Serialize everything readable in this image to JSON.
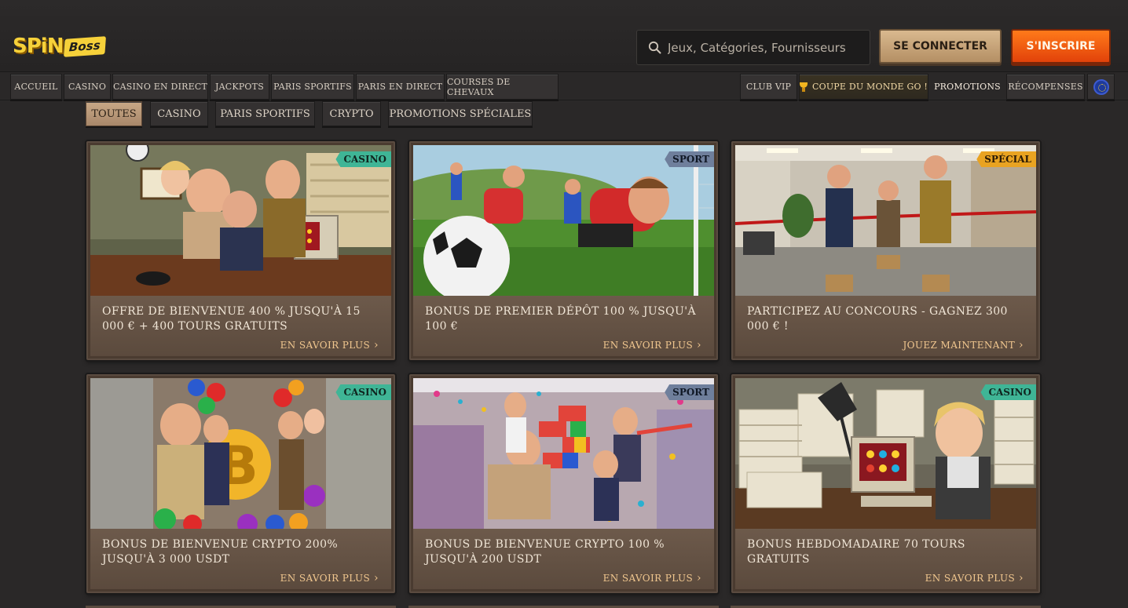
{
  "header": {
    "logo_main": "SPiN",
    "logo_sub": "Boss",
    "search_placeholder": "Jeux, Catégories, Fournisseurs",
    "login_label": "SE CONNECTER",
    "signup_label": "S'INSCRIRE"
  },
  "nav": {
    "left": [
      "ACCUEIL",
      "CASINO",
      "CASINO EN DIRECT",
      "JACKPOTS",
      "PARIS SPORTIFS",
      "PARIS EN DIRECT",
      "COURSES DE CHEVAUX"
    ],
    "club_vip": "CLUB VIP",
    "world_cup": "COUPE DU MONDE GO !",
    "promotions": "PROMOTIONS",
    "rewards": "RÉCOMPENSES"
  },
  "filters": [
    "TOUTES",
    "CASINO",
    "PARIS SPORTIFS",
    "CRYPTO",
    "PROMOTIONS SPÉCIALES"
  ],
  "cards": [
    {
      "tag": "CASINO",
      "title": "OFFRE DE BIENVENUE 400 % JUSQU'À 15 000 € + 400 TOURS GRATUITS",
      "cta": "EN SAVOIR PLUS"
    },
    {
      "tag": "SPORT",
      "title": "BONUS DE PREMIER DÉPÔT 100 % JUSQU'À 100 €",
      "cta": "EN SAVOIR PLUS"
    },
    {
      "tag": "SPÉCIAL",
      "title": "PARTICIPEZ AU CONCOURS - GAGNEZ 300 000 € !",
      "cta": "JOUEZ MAINTENANT"
    },
    {
      "tag": "CASINO",
      "title": "BONUS DE BIENVENUE CRYPTO 200% JUSQU'À 3 000 USDT",
      "cta": "EN SAVOIR PLUS"
    },
    {
      "tag": "SPORT",
      "title": "BONUS DE BIENVENUE CRYPTO 100 % JUSQU'À 200 USDT",
      "cta": "EN SAVOIR PLUS"
    },
    {
      "tag": "CASINO",
      "title": "BONUS HEBDOMADAIRE 70 TOURS GRATUITS",
      "cta": "EN SAVOIR PLUS"
    }
  ],
  "colors": {
    "background": "#2a2828",
    "accent_orange": "#ff7a1a",
    "accent_tan": "#d9b98f",
    "card_body": "#6d5a4b",
    "cta_text": "#f1c78f",
    "tag_casino": "#3fb596",
    "tag_sport": "#6f7f9c",
    "tag_special": "#e9a321"
  }
}
